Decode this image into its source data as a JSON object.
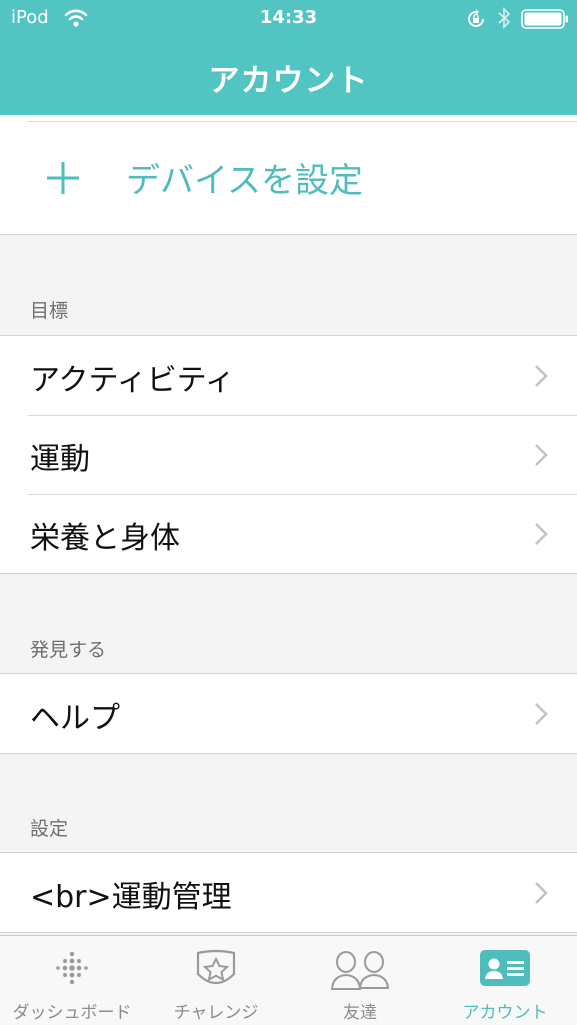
{
  "status_bar": {
    "carrier": "iPod",
    "time": "14:33"
  },
  "nav": {
    "title": "アカウント"
  },
  "add_device": {
    "label": "デバイスを設定"
  },
  "sections": [
    {
      "header": "目標",
      "rows": [
        {
          "label": "アクティビティ"
        },
        {
          "label": "運動"
        },
        {
          "label": "栄養と身体"
        }
      ]
    },
    {
      "header": "発見する",
      "rows": [
        {
          "label": "ヘルプ"
        }
      ]
    },
    {
      "header": "設定",
      "rows": [
        {
          "label": "<br>運動管理"
        }
      ]
    }
  ],
  "tab_bar": {
    "tabs": [
      {
        "label": "ダッシュボード",
        "icon": "dashboard-dots-icon"
      },
      {
        "label": "チャレンジ",
        "icon": "star-badge-icon"
      },
      {
        "label": "友達",
        "icon": "friends-icon"
      },
      {
        "label": "アカウント",
        "icon": "account-card-icon",
        "active": true
      }
    ]
  },
  "colors": {
    "accent": "#52c4c2",
    "accent_text": "#4fbdbb",
    "background": "#f4f4f4"
  }
}
